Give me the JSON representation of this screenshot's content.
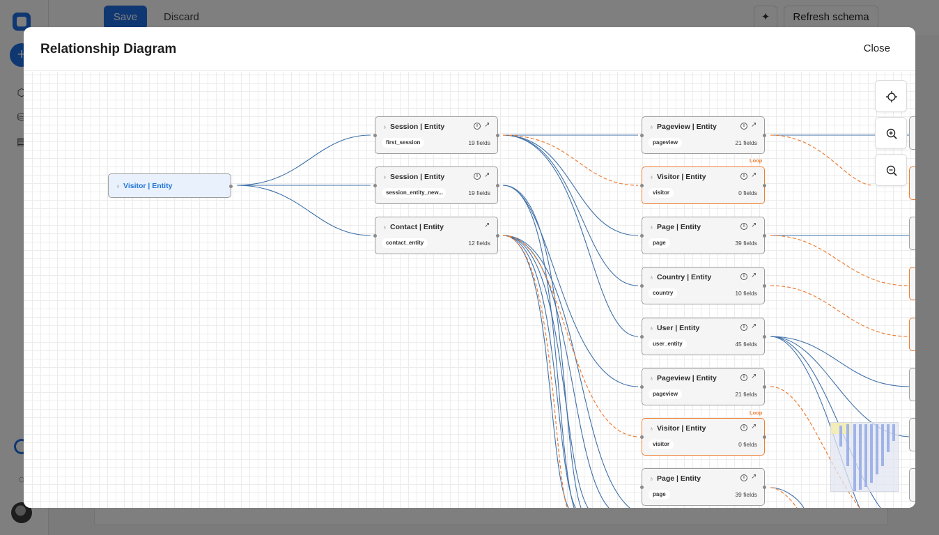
{
  "app": {
    "save_label": "Save",
    "discard_label": "Discard",
    "refresh_label": "Refresh schema"
  },
  "modal": {
    "title": "Relationship Diagram",
    "close_label": "Close"
  },
  "colors": {
    "edge_solid": "#3f70a8",
    "edge_loop": "#ee7d32",
    "root_highlight": "#1f74d6"
  },
  "loop_label": "Loop",
  "nodes": {
    "root": {
      "title": "Visitor | Entity"
    },
    "n1": {
      "title": "Session | Entity",
      "pill": "first_session",
      "fields": "19 fields"
    },
    "n2": {
      "title": "Session | Entity",
      "pill": "session_entity_new...",
      "fields": "19 fields"
    },
    "n3": {
      "title": "Contact | Entity",
      "pill": "contact_entity",
      "fields": "12 fields"
    },
    "n4": {
      "title": "Pageview | Entity",
      "pill": "pageview",
      "fields": "21 fields"
    },
    "n5": {
      "title": "Visitor | Entity",
      "pill": "visitor",
      "fields": "0 fields"
    },
    "n6": {
      "title": "Page | Entity",
      "pill": "page",
      "fields": "39 fields"
    },
    "n7": {
      "title": "Country | Entity",
      "pill": "country",
      "fields": "10 fields"
    },
    "n8": {
      "title": "User | Entity",
      "pill": "user_entity",
      "fields": "45 fields"
    },
    "n9": {
      "title": "Pageview | Entity",
      "pill": "pageview",
      "fields": "21 fields"
    },
    "n10": {
      "title": "Visitor | Entity",
      "pill": "visitor",
      "fields": "0 fields"
    },
    "n11": {
      "title": "Page | Entity",
      "pill": "page",
      "fields": "39 fields"
    }
  },
  "controls": {
    "recenter_icon": "crosshair-icon",
    "zoom_in_icon": "zoom-in-icon",
    "zoom_out_icon": "zoom-out-icon"
  }
}
